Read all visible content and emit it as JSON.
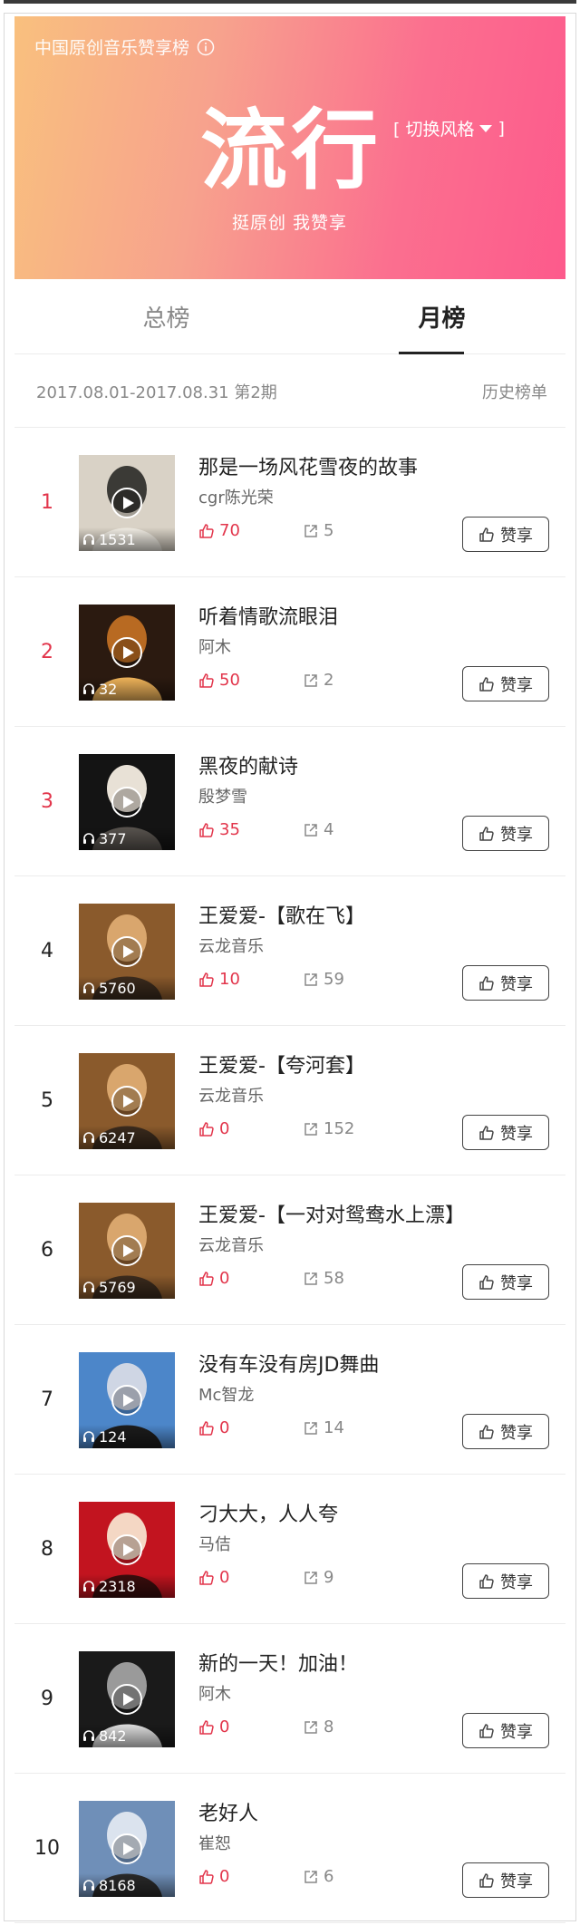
{
  "header": {
    "subtitle": "中国原创音乐赞享榜",
    "title": "流行",
    "slogan": "挺原创 我赞享",
    "style_switch": "[ 切换风格",
    "style_switch_end": "]",
    "colors": {
      "gradient_start": "#f9c07e",
      "gradient_end": "#fd5a8c"
    }
  },
  "tabs": [
    {
      "label": "总榜",
      "active": false
    },
    {
      "label": "月榜",
      "active": true
    }
  ],
  "period": {
    "text": "2017.08.01-2017.08.31 第2期",
    "history_label": "历史榜单"
  },
  "like_button_label": "赞享",
  "songs": [
    {
      "rank": "1",
      "title": "那是一场风花雪夜的故事",
      "artist": "cgr陈光荣",
      "plays": "1531",
      "likes": "70",
      "shares": "5"
    },
    {
      "rank": "2",
      "title": "听着情歌流眼泪",
      "artist": "阿木",
      "plays": "32",
      "likes": "50",
      "shares": "2"
    },
    {
      "rank": "3",
      "title": "黑夜的献诗",
      "artist": "殷梦雪",
      "plays": "377",
      "likes": "35",
      "shares": "4"
    },
    {
      "rank": "4",
      "title": "王爱爱-【歌在飞】",
      "artist": "云龙音乐",
      "plays": "5760",
      "likes": "10",
      "shares": "59"
    },
    {
      "rank": "5",
      "title": "王爱爱-【夸河套】",
      "artist": "云龙音乐",
      "plays": "6247",
      "likes": "0",
      "shares": "152"
    },
    {
      "rank": "6",
      "title": "王爱爱-【一对对鸳鸯水上漂】",
      "artist": "云龙音乐",
      "plays": "5769",
      "likes": "0",
      "shares": "58"
    },
    {
      "rank": "7",
      "title": "没有车没有房JD舞曲",
      "artist": "Mc智龙",
      "plays": "124",
      "likes": "0",
      "shares": "14"
    },
    {
      "rank": "8",
      "title": "刁大大，人人夸",
      "artist": "马佶",
      "plays": "2318",
      "likes": "0",
      "shares": "9"
    },
    {
      "rank": "9",
      "title": "新的一天！加油！",
      "artist": "阿木",
      "plays": "842",
      "likes": "0",
      "shares": "8"
    },
    {
      "rank": "10",
      "title": "老好人",
      "artist": "崔恕",
      "plays": "8168",
      "likes": "0",
      "shares": "6"
    }
  ]
}
